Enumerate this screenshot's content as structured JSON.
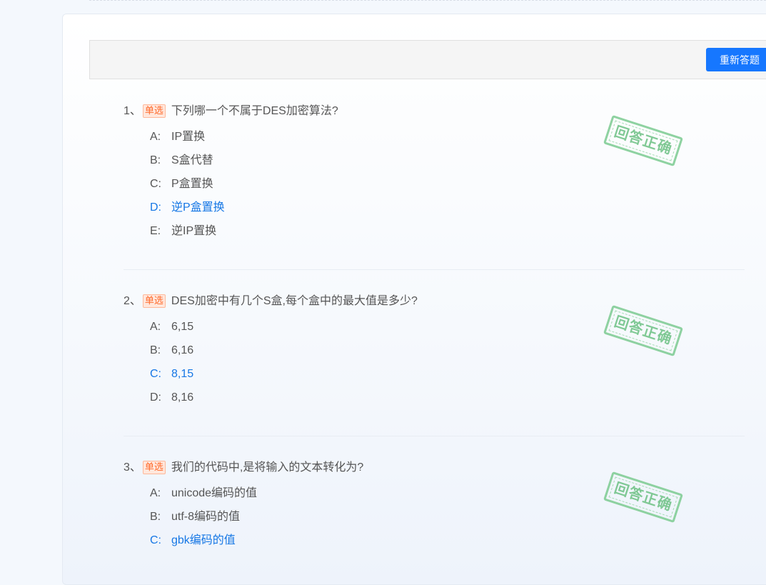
{
  "toolbar": {
    "redo_label": "重新答题"
  },
  "stamp_label": "回答正确",
  "colors": {
    "primary": "#1677ff",
    "correct_text": "#1677e5",
    "tag_orange": "#ff6a2b",
    "stamp_green": "#6cc183"
  },
  "questions": [
    {
      "number": "1、",
      "type": "单选",
      "text": "下列哪一个不属于DES加密算法?",
      "options": [
        {
          "letter": "A:",
          "text": "IP置换"
        },
        {
          "letter": "B:",
          "text": "S盒代替"
        },
        {
          "letter": "C:",
          "text": "P盒置换"
        },
        {
          "letter": "D:",
          "text": "逆P盒置换"
        },
        {
          "letter": "E:",
          "text": "逆IP置换"
        }
      ],
      "correct": "D"
    },
    {
      "number": "2、",
      "type": "单选",
      "text": "DES加密中有几个S盒,每个盒中的最大值是多少?",
      "options": [
        {
          "letter": "A:",
          "text": "6,15"
        },
        {
          "letter": "B:",
          "text": "6,16"
        },
        {
          "letter": "C:",
          "text": "8,15"
        },
        {
          "letter": "D:",
          "text": "8,16"
        }
      ],
      "correct": "C"
    },
    {
      "number": "3、",
      "type": "单选",
      "text": "我们的代码中,是将输入的文本转化为?",
      "options": [
        {
          "letter": "A:",
          "text": "unicode编码的值"
        },
        {
          "letter": "B:",
          "text": "utf-8编码的值"
        },
        {
          "letter": "C:",
          "text": "gbk编码的值"
        }
      ],
      "correct": "C"
    }
  ]
}
